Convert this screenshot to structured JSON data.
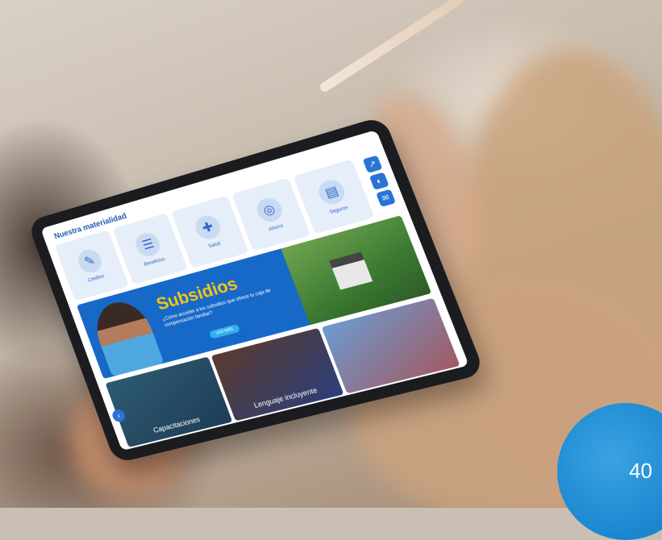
{
  "tablet": {
    "section_title": "Nuestra materialidad",
    "services": [
      {
        "label": "Créditos",
        "icon": "pen-icon"
      },
      {
        "label": "Beneficios",
        "icon": "clipboard-icon"
      },
      {
        "label": "Salud",
        "icon": "health-icon"
      },
      {
        "label": "Ahorro",
        "icon": "savings-icon"
      },
      {
        "label": "Seguros",
        "icon": "document-icon"
      }
    ],
    "banner": {
      "headline": "Subsidios",
      "subtext": "¿Cómo acceder a los subsidios que ofrece tu caja de compensación familiar?",
      "cta": "VER MÁS"
    },
    "cards": [
      {
        "caption": "Capacitaciones"
      },
      {
        "caption": "Lenguaje incluyente"
      },
      {
        "caption": ""
      }
    ]
  },
  "page_number": "40",
  "colors": {
    "brand_blue": "#1769c8",
    "headline_yellow": "#f7c419",
    "badge_blue": "#1a86cf"
  }
}
